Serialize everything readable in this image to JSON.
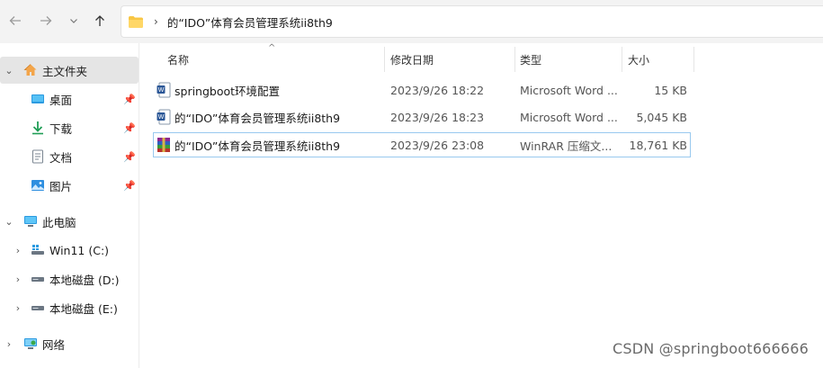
{
  "nav": {
    "address_path": "的“IDO”体育会员管理系统ii8th9"
  },
  "sidebar": {
    "items": [
      {
        "label": "主文件夹",
        "icon": "home-icon"
      },
      {
        "label": "桌面",
        "icon": "desktop-icon"
      },
      {
        "label": "下载",
        "icon": "download-icon"
      },
      {
        "label": "文档",
        "icon": "document-icon"
      },
      {
        "label": "图片",
        "icon": "picture-icon"
      },
      {
        "label": "此电脑",
        "icon": "computer-icon"
      },
      {
        "label": "Win11 (C:)",
        "icon": "drive-windows-icon"
      },
      {
        "label": "本地磁盘 (D:)",
        "icon": "drive-icon"
      },
      {
        "label": "本地磁盘 (E:)",
        "icon": "drive-icon"
      },
      {
        "label": "网络",
        "icon": "network-icon"
      }
    ]
  },
  "columns": [
    "名称",
    "修改日期",
    "类型",
    "大小"
  ],
  "files": [
    {
      "name": "springboot环境配置",
      "date": "2023/9/26 18:22",
      "type": "Microsoft Word ...",
      "size": "15 KB",
      "icon": "word-icon"
    },
    {
      "name": "的“IDO”体育会员管理系统ii8th9",
      "date": "2023/9/26 18:23",
      "type": "Microsoft Word ...",
      "size": "5,045 KB",
      "icon": "word-icon"
    },
    {
      "name": "的“IDO”体育会员管理系统ii8th9",
      "date": "2023/9/26 23:08",
      "type": "WinRAR 压缩文...",
      "size": "18,761 KB",
      "icon": "winrar-icon"
    }
  ],
  "watermark": "CSDN @springboot666666",
  "colors": {
    "accent": "#0067c0",
    "selection_border": "#99c9ef",
    "folder": "#f8c644"
  }
}
